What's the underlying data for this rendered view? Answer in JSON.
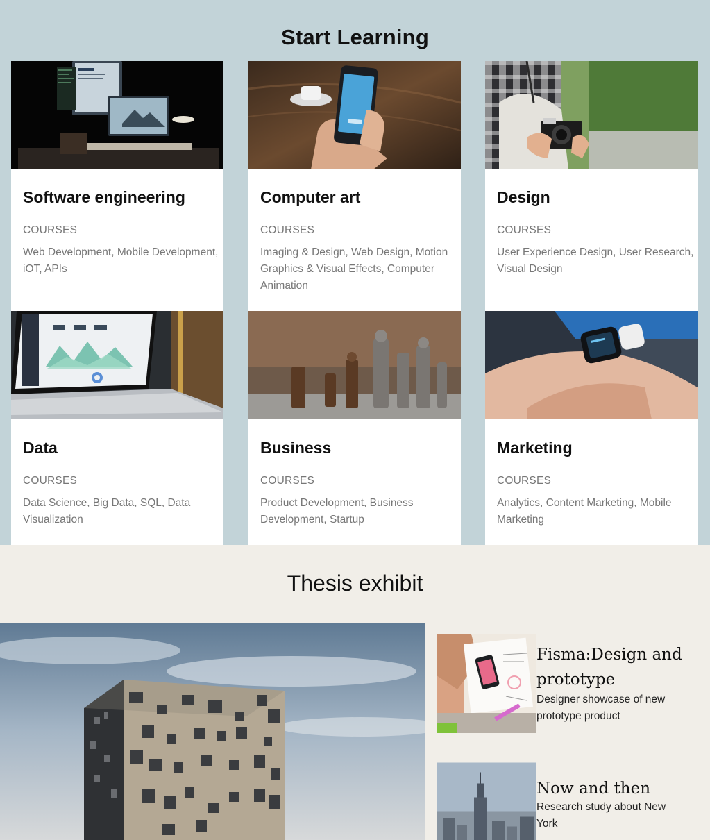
{
  "learning": {
    "title": "Start Learning",
    "cards": [
      {
        "title": "Software engineering",
        "label": "COURSES",
        "description": "Web Development, Mobile Development, iOT, APIs",
        "image": "desk-computer-monitors-photo"
      },
      {
        "title": "Computer art",
        "label": "COURSES",
        "description": "Imaging & Design, Web Design, Motion Graphics & Visual Effects, Computer Animation",
        "image": "hand-holding-phone-photo"
      },
      {
        "title": "Design",
        "label": "COURSES",
        "description": "User Experience Design, User Research, Visual Design",
        "image": "person-with-camera-photo"
      },
      {
        "title": "Data",
        "label": "COURSES",
        "description": "Data Science, Big Data, SQL, Data Visualization",
        "image": "laptop-dashboard-photo"
      },
      {
        "title": "Business",
        "label": "COURSES",
        "description": "Product Development, Business Development, Startup",
        "image": "chess-pieces-photo"
      },
      {
        "title": "Marketing",
        "label": "COURSES",
        "description": "Analytics, Content Marketing, Mobile Marketing",
        "image": "smartwatch-hand-photo"
      }
    ]
  },
  "thesis": {
    "title": "Thesis exhibit",
    "hero_image": "building-against-sky-photo",
    "items": [
      {
        "title": "Fisma:Design and prototype",
        "description": "Designer showcase of new prototype product",
        "image": "desk-sketching-phone-photo"
      },
      {
        "title": "Now and then",
        "description": "Research study about New York",
        "image": "new-york-skyline-photo"
      }
    ]
  },
  "colors": {
    "learning_bg": "#c2d3d8",
    "thesis_bg": "#f1eee8",
    "muted_text": "#777777"
  }
}
